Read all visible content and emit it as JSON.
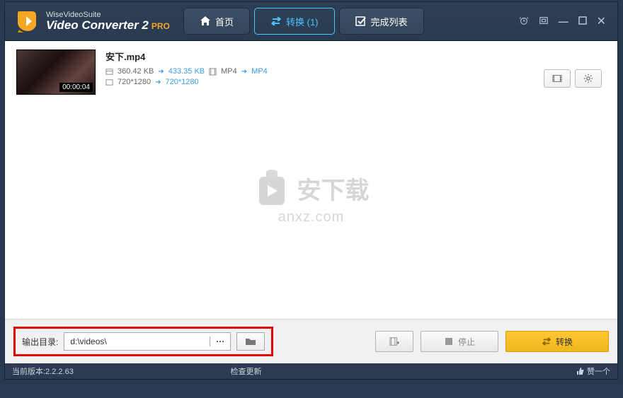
{
  "header": {
    "brand_line1": "WiseVideoSuite",
    "brand_line2": "Video Converter 2",
    "pro_badge": "PRO",
    "tabs": {
      "home": "首页",
      "convert": "转换 (1)",
      "done": "完成列表"
    }
  },
  "file": {
    "name": "安下.mp4",
    "duration": "00:00:04",
    "size_in": "360.42 KB",
    "size_out": "433.35 KB",
    "fmt_in": "MP4",
    "fmt_out": "MP4",
    "res_in": "720*1280",
    "res_out": "720*1280"
  },
  "watermark": {
    "text1": "安下载",
    "text2": "anxz.com"
  },
  "footer": {
    "output_label": "输出目录:",
    "output_path": "d:\\videos\\",
    "ellipsis": "···",
    "stop": "停止",
    "convert": "转换"
  },
  "status": {
    "version": "当前版本:2.2.2.63",
    "check_update": "检查更新",
    "like": "赞一个"
  }
}
